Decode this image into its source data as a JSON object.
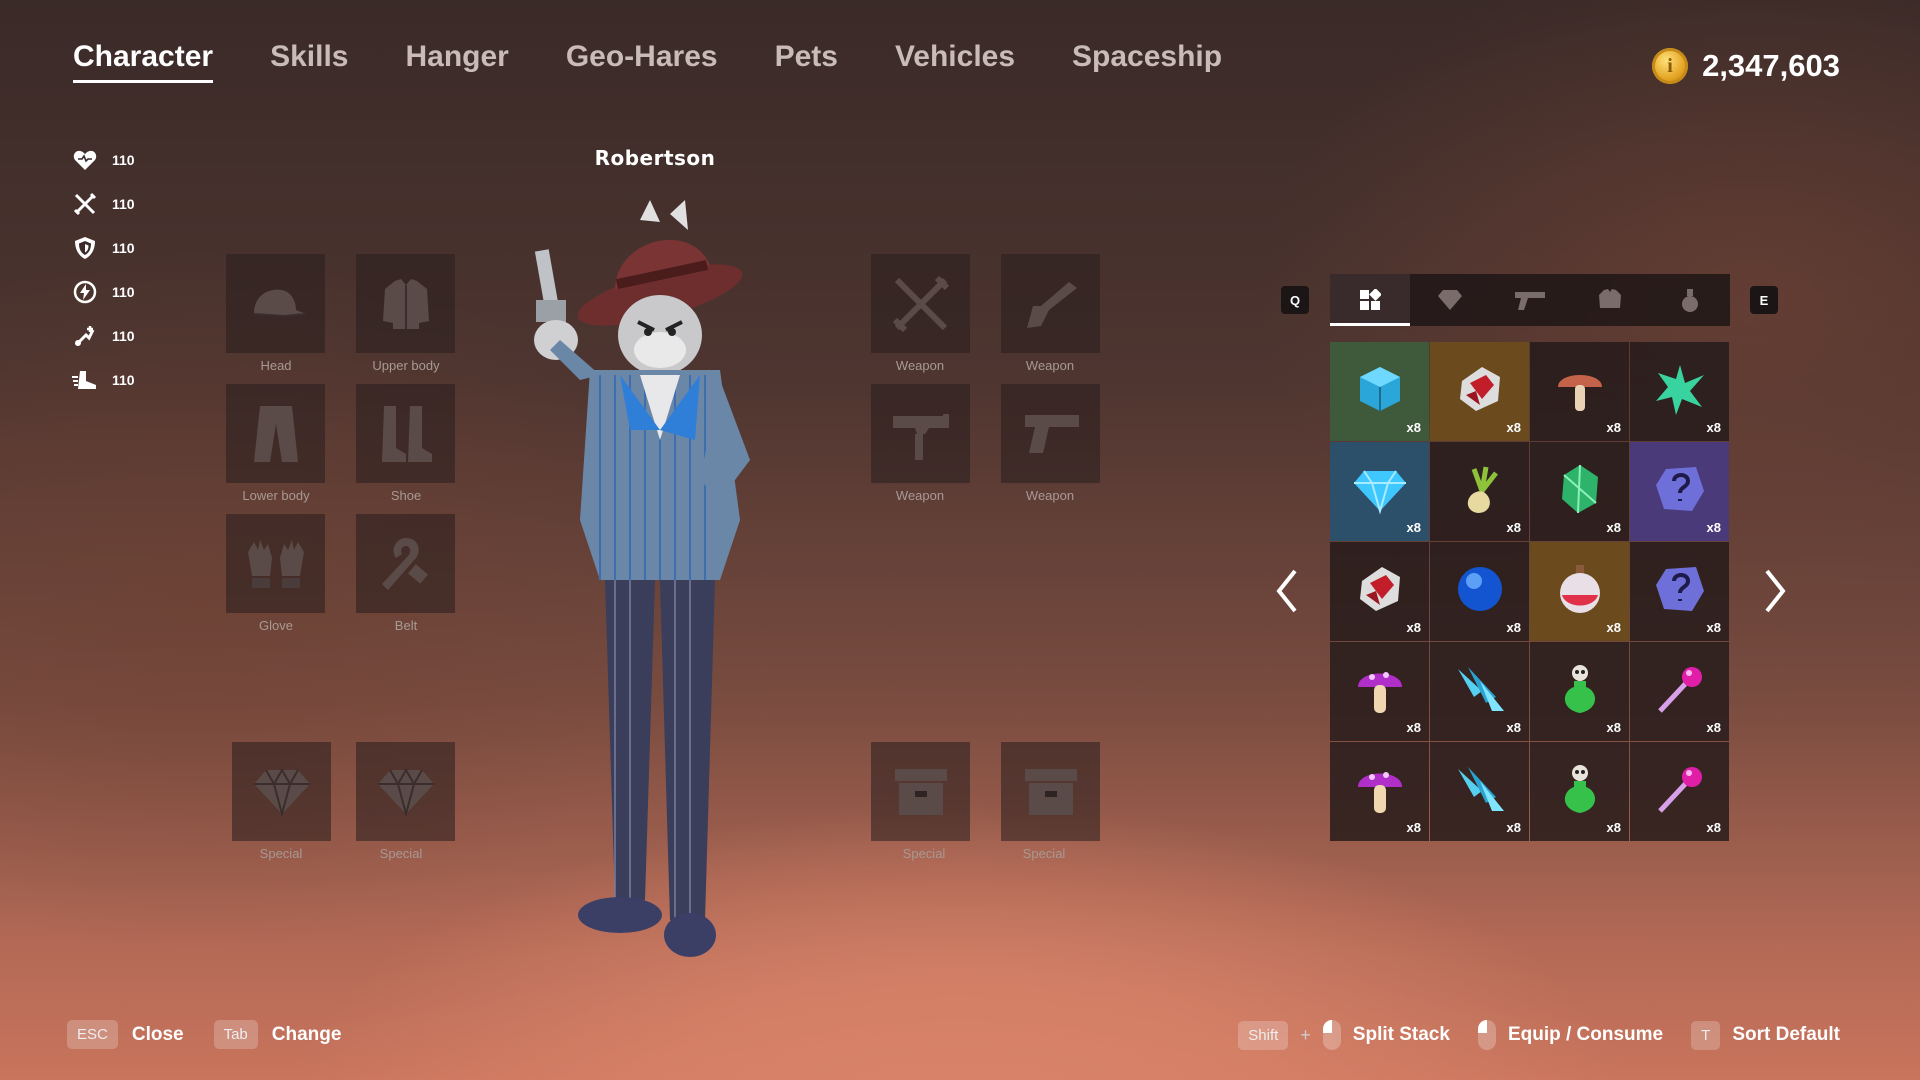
{
  "tabs": [
    "Character",
    "Skills",
    "Hanger",
    "Geo-Hares",
    "Pets",
    "Vehicles",
    "Spaceship"
  ],
  "currency": {
    "amount": "2,347,603",
    "icon": "gold-coin-icon"
  },
  "stats": [
    {
      "icon": "heart-icon",
      "value": "110"
    },
    {
      "icon": "crossed-swords-icon",
      "value": "110"
    },
    {
      "icon": "shield-icon",
      "value": "110"
    },
    {
      "icon": "energy-icon",
      "value": "110"
    },
    {
      "icon": "speed-icon",
      "value": "110"
    },
    {
      "icon": "boot-dash-icon",
      "value": "110"
    }
  ],
  "character": {
    "name": "Robertson"
  },
  "equipment": {
    "head": "Head",
    "upper_body": "Upper body",
    "lower_body": "Lower body",
    "shoe": "Shoe",
    "glove": "Glove",
    "belt": "Belt",
    "weapon1": "Weapon",
    "weapon2": "Weapon",
    "weapon3": "Weapon",
    "weapon4": "Weapon",
    "special1": "Special",
    "special2": "Special",
    "special3": "Special",
    "special4": "Special"
  },
  "inventory": {
    "key_prev": "Q",
    "key_next": "E",
    "tabs": [
      "all-items-icon",
      "gem-icon",
      "gun-icon",
      "armor-icon",
      "potion-icon"
    ],
    "items": [
      {
        "icon": "blue-cube-crystal-icon",
        "qty": "x8",
        "bg": "#3f5a3a"
      },
      {
        "icon": "red-ore-icon",
        "qty": "x8",
        "bg": "#6b4a1e"
      },
      {
        "icon": "red-mushroom-icon",
        "qty": "x8",
        "bg": ""
      },
      {
        "icon": "green-star-crystal-icon",
        "qty": "x8",
        "bg": ""
      },
      {
        "icon": "blue-diamond-icon",
        "qty": "x8",
        "bg": "#2c4f6a"
      },
      {
        "icon": "onion-icon",
        "qty": "x8",
        "bg": ""
      },
      {
        "icon": "green-gem-icon",
        "qty": "x8",
        "bg": ""
      },
      {
        "icon": "purple-rune-stone-icon",
        "qty": "x8",
        "bg": "#4a3a7a"
      },
      {
        "icon": "red-ore-icon",
        "qty": "x8",
        "bg": ""
      },
      {
        "icon": "blue-orb-icon",
        "qty": "x8",
        "bg": ""
      },
      {
        "icon": "red-potion-icon",
        "qty": "x8",
        "bg": "#6b4a1e"
      },
      {
        "icon": "purple-rune-stone-icon",
        "qty": "x8",
        "bg": ""
      },
      {
        "icon": "purple-mushroom-icon",
        "qty": "x8",
        "bg": ""
      },
      {
        "icon": "ice-crystal-icon",
        "qty": "x8",
        "bg": ""
      },
      {
        "icon": "skull-poison-potion-icon",
        "qty": "x8",
        "bg": ""
      },
      {
        "icon": "magic-wand-icon",
        "qty": "x8",
        "bg": ""
      },
      {
        "icon": "purple-mushroom-icon",
        "qty": "x8",
        "bg": ""
      },
      {
        "icon": "ice-crystal-icon",
        "qty": "x8",
        "bg": ""
      },
      {
        "icon": "skull-poison-potion-icon",
        "qty": "x8",
        "bg": ""
      },
      {
        "icon": "magic-wand-icon",
        "qty": "x8",
        "bg": ""
      }
    ]
  },
  "hints": {
    "esc_key": "ESC",
    "close": "Close",
    "tab_key": "Tab",
    "change": "Change",
    "shift_key": "Shift",
    "plus": "+",
    "split": "Split Stack",
    "equip": "Equip / Consume",
    "t_key": "T",
    "sort": "Sort Default"
  }
}
